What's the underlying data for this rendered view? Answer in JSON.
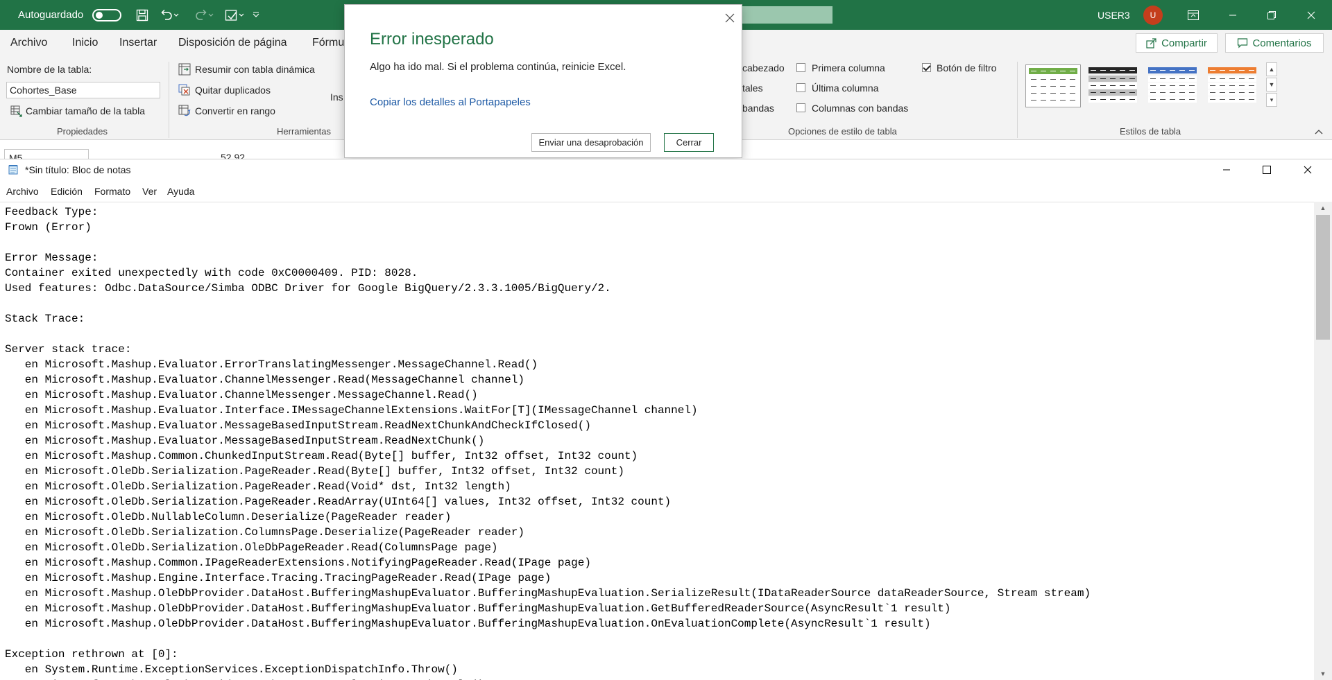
{
  "excel": {
    "titlebar": {
      "autosave_label": "Autoguardado",
      "autosave_state": "off",
      "user_name": "USER3",
      "user_initial": "U"
    },
    "tabs": [
      "Archivo",
      "Inicio",
      "Insertar",
      "Disposición de página",
      "Fórmu"
    ],
    "share_label": "Compartir",
    "comments_label": "Comentarios",
    "ribbon": {
      "propiedades": {
        "table_name_label": "Nombre de la tabla:",
        "table_name_value": "Cohortes_Base",
        "resize_label": "Cambiar tamaño de la tabla",
        "group_label": "Propiedades"
      },
      "herramientas": {
        "pivot_label": "Resumir con tabla dinámica",
        "dedupe_label": "Quitar duplicados",
        "convert_label": "Convertir en rango",
        "group_label": "Herramientas",
        "partial_label": "Ins"
      },
      "opciones_estilo": {
        "col1": [
          "cabezado",
          "tales",
          "bandas"
        ],
        "first_column": "Primera columna",
        "last_column": "Última columna",
        "banded_columns": "Columnas con bandas",
        "filter_button": "Botón de filtro",
        "filter_checked": true,
        "group_label": "Opciones de estilo de tabla"
      },
      "estilos": {
        "group_label": "Estilos de tabla",
        "thumb_colors": [
          "#70ad47",
          "#262626",
          "#4472c4",
          "#ed7d31"
        ]
      }
    },
    "formula_bar": {
      "name_box": "M5",
      "value": "52.92"
    }
  },
  "dialog": {
    "title": "Error inesperado",
    "message": "Algo ha ido mal. Si el problema continúa, reinicie Excel.",
    "copy_link": "Copiar los detalles al Portapapeles",
    "frown_button": "Enviar una desaprobación",
    "close_button": "Cerrar"
  },
  "notepad": {
    "title": "*Sin título: Bloc de notas",
    "menu": [
      "Archivo",
      "Edición",
      "Formato",
      "Ver",
      "Ayuda"
    ],
    "content": "Feedback Type:\nFrown (Error)\n\nError Message:\nContainer exited unexpectedly with code 0xC0000409. PID: 8028.\nUsed features: Odbc.DataSource/Simba ODBC Driver for Google BigQuery/2.3.3.1005/BigQuery/2.\n\nStack Trace:\n\nServer stack trace:\n   en Microsoft.Mashup.Evaluator.ErrorTranslatingMessenger.MessageChannel.Read()\n   en Microsoft.Mashup.Evaluator.ChannelMessenger.Read(MessageChannel channel)\n   en Microsoft.Mashup.Evaluator.ChannelMessenger.MessageChannel.Read()\n   en Microsoft.Mashup.Evaluator.Interface.IMessageChannelExtensions.WaitFor[T](IMessageChannel channel)\n   en Microsoft.Mashup.Evaluator.MessageBasedInputStream.ReadNextChunkAndCheckIfClosed()\n   en Microsoft.Mashup.Evaluator.MessageBasedInputStream.ReadNextChunk()\n   en Microsoft.Mashup.Common.ChunkedInputStream.Read(Byte[] buffer, Int32 offset, Int32 count)\n   en Microsoft.OleDb.Serialization.PageReader.Read(Byte[] buffer, Int32 offset, Int32 count)\n   en Microsoft.OleDb.Serialization.PageReader.Read(Void* dst, Int32 length)\n   en Microsoft.OleDb.Serialization.PageReader.ReadArray(UInt64[] values, Int32 offset, Int32 count)\n   en Microsoft.OleDb.NullableColumn.Deserialize(PageReader reader)\n   en Microsoft.OleDb.Serialization.ColumnsPage.Deserialize(PageReader reader)\n   en Microsoft.OleDb.Serialization.OleDbPageReader.Read(ColumnsPage page)\n   en Microsoft.Mashup.Common.IPageReaderExtensions.NotifyingPageReader.Read(IPage page)\n   en Microsoft.Mashup.Engine.Interface.Tracing.TracingPageReader.Read(IPage page)\n   en Microsoft.Mashup.OleDbProvider.DataHost.BufferingMashupEvaluator.BufferingMashupEvaluation.SerializeResult(IDataReaderSource dataReaderSource, Stream stream)\n   en Microsoft.Mashup.OleDbProvider.DataHost.BufferingMashupEvaluator.BufferingMashupEvaluation.GetBufferedReaderSource(AsyncResult`1 result)\n   en Microsoft.Mashup.OleDbProvider.DataHost.BufferingMashupEvaluator.BufferingMashupEvaluation.OnEvaluationComplete(AsyncResult`1 result)\n\nException rethrown at [0]:\n   en System.Runtime.ExceptionServices.ExceptionDispatchInfo.Throw()\n   en Microsoft.Mashup.OleDbProvider.MashupServerEvaluation.ReadResult()"
  }
}
